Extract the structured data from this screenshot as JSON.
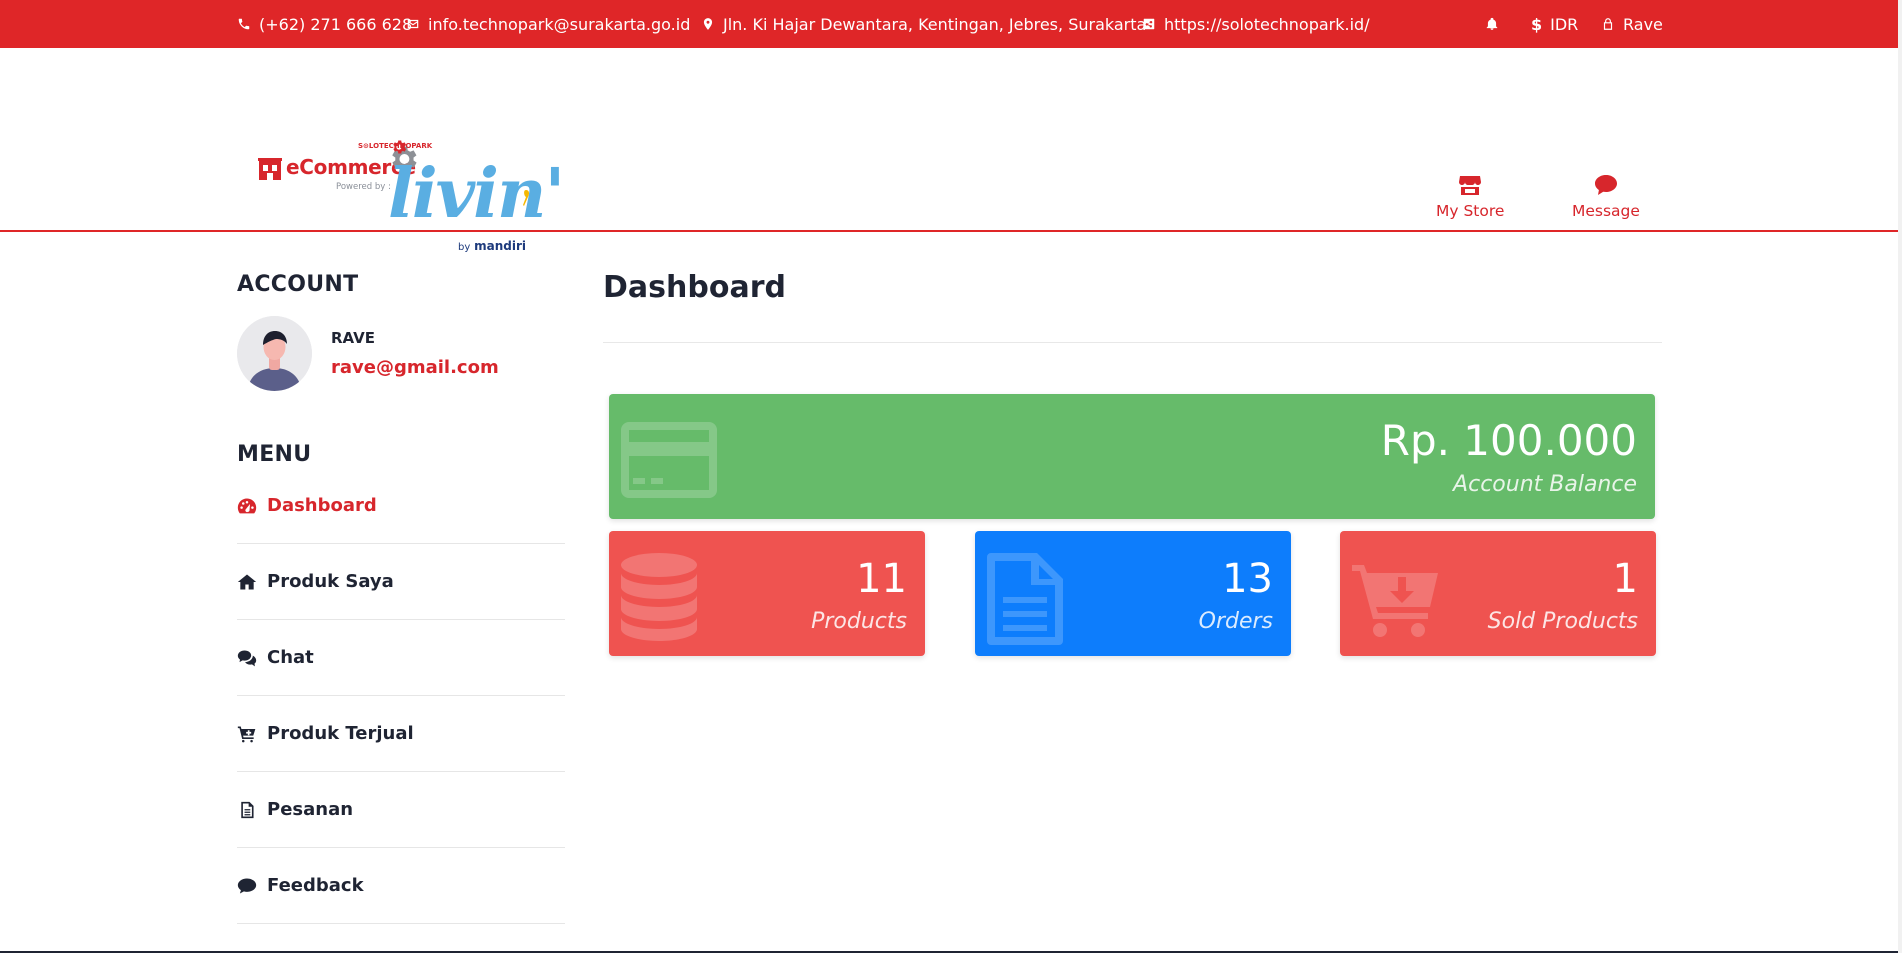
{
  "topbar": {
    "phone": "(+62) 271 666 628",
    "email": "info.technopark@surakarta.go.id",
    "address": "Jln. Ki Hajar Dewantara, Kentingan, Jebres, Surakarta",
    "website": "https://solotechnopark.id/",
    "currency": "IDR",
    "user": "Rave"
  },
  "logo": {
    "ecommerce": "eCommerce",
    "solo_technopark": "S⊙LOTECHNOPARK",
    "powered_by": "Powered by :",
    "brand": "livin'",
    "by_mandiri_prefix": "by",
    "by_mandiri": "mandiri"
  },
  "header_links": {
    "my_store": "My Store",
    "message": "Message"
  },
  "sidebar": {
    "account_title": "ACCOUNT",
    "account_name": "RAVE",
    "account_email": "rave@gmail.com",
    "menu_title": "MENU",
    "menu": [
      {
        "label": "Dashboard",
        "icon": "dashboard-gauge-icon",
        "active": true
      },
      {
        "label": "Produk Saya",
        "icon": "home-icon"
      },
      {
        "label": "Chat",
        "icon": "chat-bubbles-icon"
      },
      {
        "label": "Produk Terjual",
        "icon": "cart-plus-icon"
      },
      {
        "label": "Pesanan",
        "icon": "document-icon"
      },
      {
        "label": "Feedback",
        "icon": "comment-icon"
      }
    ]
  },
  "main": {
    "title": "Dashboard",
    "cards": {
      "balance": {
        "value": "Rp. 100.000",
        "label": "Account Balance",
        "color": "#66bb6a",
        "icon": "credit-card-icon"
      },
      "products": {
        "value": "11",
        "label": "Products",
        "color": "#ef5350",
        "icon": "database-icon"
      },
      "orders": {
        "value": "13",
        "label": "Orders",
        "color": "#0d7dfc",
        "icon": "file-text-icon"
      },
      "sold": {
        "value": "1",
        "label": "Sold Products",
        "color": "#ef5350",
        "icon": "cart-download-icon"
      }
    }
  },
  "colors": {
    "brand_red": "#df2628",
    "text_dark": "#1f2433",
    "livin_blue": "#5aaee2"
  }
}
